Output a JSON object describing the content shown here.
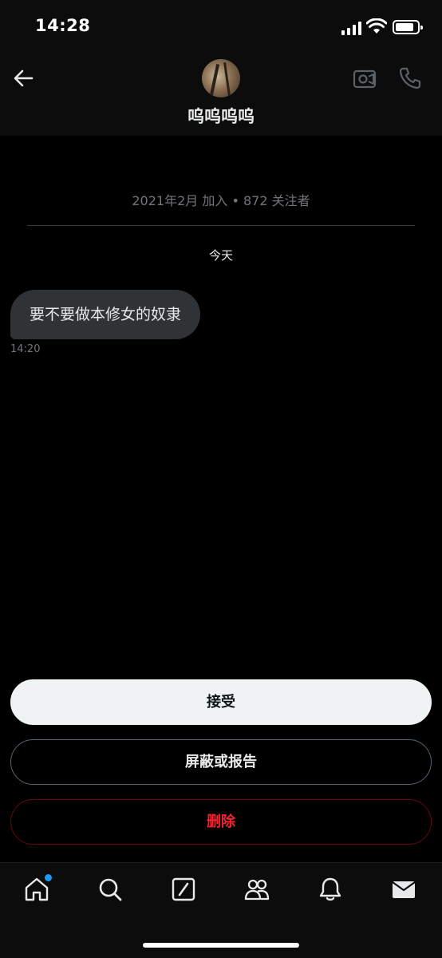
{
  "status_bar": {
    "time": "14:28",
    "battery_level": 0.85
  },
  "header": {
    "contact_name": "呜呜呜呜"
  },
  "conversation": {
    "meta": "2021年2月 加入 • 872 关注者",
    "day_label": "今天",
    "messages": [
      {
        "text": "要不要做本修女的奴隶",
        "time": "14:20",
        "direction": "incoming"
      }
    ]
  },
  "actions": {
    "accept_label": "接受",
    "block_label": "屏蔽或报告",
    "delete_label": "删除"
  },
  "tab_bar": {
    "tabs": [
      {
        "icon": "home-icon",
        "has_badge": true
      },
      {
        "icon": "search-icon",
        "has_badge": false
      },
      {
        "icon": "compose-icon",
        "has_badge": false
      },
      {
        "icon": "communities-icon",
        "has_badge": false
      },
      {
        "icon": "bell-icon",
        "has_badge": false
      },
      {
        "icon": "mail-icon",
        "has_badge": false
      }
    ]
  },
  "colors": {
    "background": "#000000",
    "bubble": "#2f3336",
    "secondary_text": "#71767b",
    "accent": "#1d9bf0",
    "danger": "#f4212e"
  }
}
